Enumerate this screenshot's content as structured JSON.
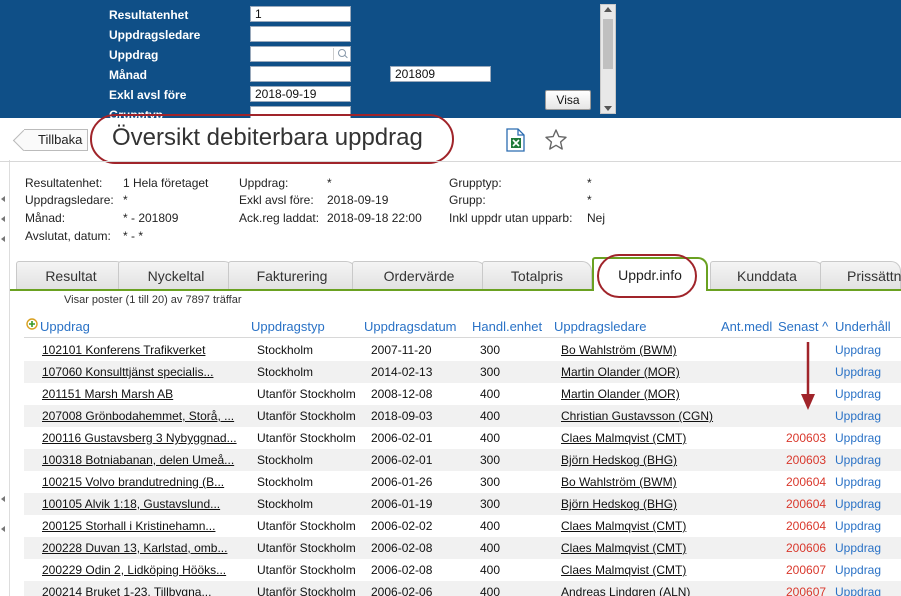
{
  "filter": {
    "labels": [
      "Resultatenhet",
      "Uppdragsledare",
      "Uppdrag",
      "Månad",
      "Exkl avsl före",
      "Grupptyp"
    ],
    "resultatenhet_value": "1",
    "uppdragsledare_value": "",
    "uppdrag_value": "",
    "manad_from_value": "",
    "manad_to_value": "201809",
    "exkl_avsl_fore_value": "2018-09-19",
    "visa_label": "Visa"
  },
  "header": {
    "back_label": "Tillbaka",
    "title": "Översikt debiterbara uppdrag",
    "excel_icon": "excel-export-icon",
    "star_icon": "favorite-star-icon"
  },
  "summary": {
    "col1": [
      {
        "label": "Resultatenhet:",
        "value": "1 Hela företaget"
      },
      {
        "label": "Uppdragsledare:",
        "value": "*"
      },
      {
        "label": "Månad:",
        "value": "* - 201809"
      },
      {
        "label": "Avslutat, datum:",
        "value": "* - *"
      }
    ],
    "col2": [
      {
        "label": "Uppdrag:",
        "value": "*"
      },
      {
        "label": "Exkl avsl före:",
        "value": "2018-09-19"
      },
      {
        "label": "Ack.reg laddat:",
        "value": "2018-09-18 22:00"
      }
    ],
    "col3": [
      {
        "label": "Grupptyp:",
        "value": "*"
      },
      {
        "label": "Grupp:",
        "value": "*"
      },
      {
        "label": "Inkl uppdr utan upparb:",
        "value": "Nej"
      }
    ]
  },
  "tabs": [
    "Resultat",
    "Nyckeltal",
    "Fakturering",
    "Ordervärde",
    "Totalpris",
    "Uppdr.info",
    "Kunddata",
    "Prissättn"
  ],
  "active_tab": "Uppdr.info",
  "records_info": "Visar poster (1 till 20) av  7897 träffar",
  "grid": {
    "headers": [
      "Uppdrag",
      "Uppdragstyp",
      "Uppdragsdatum",
      "Handl.enhet",
      "Uppdragsledare",
      "Ant.medl",
      "Senast ^",
      "Underhåll"
    ],
    "rows": [
      {
        "uppdrag": "102101 Konferens Trafikverket",
        "typ": "Stockholm",
        "datum": "2007-11-20",
        "enhet": "300",
        "ledare": "Bo Wahlström (BWM)",
        "senast": "",
        "underhall": "Uppdrag"
      },
      {
        "uppdrag": "107060 Konsulttjänst specialis...",
        "typ": "Stockholm",
        "datum": "2014-02-13",
        "enhet": "300",
        "ledare": "Martin Olander (MOR)",
        "senast": "",
        "underhall": "Uppdrag"
      },
      {
        "uppdrag": "201151 Marsh Marsh AB",
        "typ": "Utanför Stockholm",
        "datum": "2008-12-08",
        "enhet": "400",
        "ledare": "Martin Olander (MOR)",
        "senast": "",
        "underhall": "Uppdrag"
      },
      {
        "uppdrag": "207008 Grönbodahemmet, Storå, ...",
        "typ": "Utanför Stockholm",
        "datum": "2018-09-03",
        "enhet": "400",
        "ledare": "Christian Gustavsson (CGN)",
        "senast": "",
        "underhall": "Uppdrag"
      },
      {
        "uppdrag": "200116 Gustavsberg 3 Nybyggnad...",
        "typ": "Utanför Stockholm",
        "datum": "2006-02-01",
        "enhet": "400",
        "ledare": "Claes Malmqvist (CMT)",
        "senast": "200603",
        "underhall": "Uppdrag"
      },
      {
        "uppdrag": "100318 Botniabanan, delen Umeå...",
        "typ": "Stockholm",
        "datum": "2006-02-01",
        "enhet": "300",
        "ledare": "Björn Hedskog (BHG)",
        "senast": "200603",
        "underhall": "Uppdrag"
      },
      {
        "uppdrag": "100215 Volvo brandutredning (B...",
        "typ": "Stockholm",
        "datum": "2006-01-26",
        "enhet": "300",
        "ledare": "Bo Wahlström (BWM)",
        "senast": "200604",
        "underhall": "Uppdrag"
      },
      {
        "uppdrag": "100105 Alvik 1:18, Gustavslund...",
        "typ": "Stockholm",
        "datum": "2006-01-19",
        "enhet": "300",
        "ledare": "Björn Hedskog (BHG)",
        "senast": "200604",
        "underhall": "Uppdrag"
      },
      {
        "uppdrag": "200125 Storhall i Kristinehamn...",
        "typ": "Utanför Stockholm",
        "datum": "2006-02-02",
        "enhet": "400",
        "ledare": "Claes Malmqvist (CMT)",
        "senast": "200604",
        "underhall": "Uppdrag"
      },
      {
        "uppdrag": "200228 Duvan 13, Karlstad, omb...",
        "typ": "Utanför Stockholm",
        "datum": "2006-02-08",
        "enhet": "400",
        "ledare": "Claes Malmqvist (CMT)",
        "senast": "200606",
        "underhall": "Uppdrag"
      },
      {
        "uppdrag": "200229 Odin 2, Lidköping Hööks...",
        "typ": "Utanför Stockholm",
        "datum": "2006-02-08",
        "enhet": "400",
        "ledare": "Claes Malmqvist (CMT)",
        "senast": "200607",
        "underhall": "Uppdrag"
      },
      {
        "uppdrag": "200214 Bruket 1-23, Tillbygna...",
        "typ": "Utanför Stockholm",
        "datum": "2006-02-06",
        "enhet": "400",
        "ledare": "Andreas Lindgren (ALN)",
        "senast": "200607",
        "underhall": "Uppdrag"
      }
    ]
  },
  "colors": {
    "panel_blue": "#0f4f87",
    "link_blue": "#2a72c6",
    "tab_green": "#6aa121",
    "annotation_red": "#a0242a",
    "value_red": "#d9382c"
  }
}
